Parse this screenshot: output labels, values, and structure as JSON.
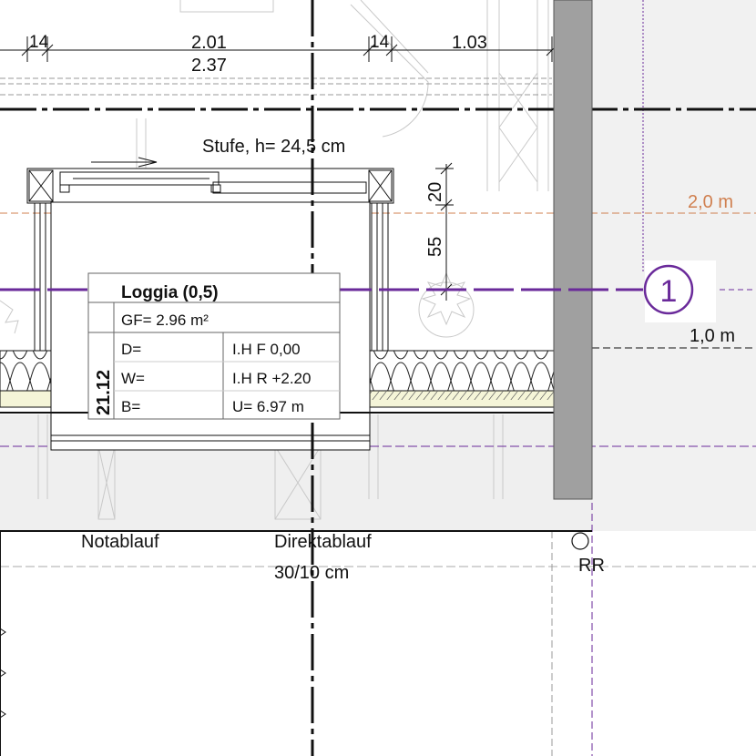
{
  "dimensions": {
    "top_left_14": "14",
    "top_mid_201": "2.01",
    "top_mid_237": "2.37",
    "top_right_14": "14",
    "top_right_103": "1.03",
    "vert_20": "20",
    "vert_55": "55"
  },
  "annotations": {
    "stufe": "Stufe, h= 24,5 cm",
    "notablauf": "Notablauf",
    "direktablauf": "Direktablauf",
    "direktablauf_size": "30/10 cm",
    "rr": "RR"
  },
  "levels": {
    "level_2": "2,0 m",
    "level_1": "1,0 m"
  },
  "axis_marker": {
    "label": "1"
  },
  "room_stamp": {
    "name": "Loggia (0,5)",
    "area": "GF= 2.96 m²",
    "number": "21.12",
    "rows": [
      {
        "left": "D=",
        "right": "I.H F 0,00"
      },
      {
        "left": "W=",
        "right": "I.H R +2.20"
      },
      {
        "left": "B=",
        "right": "U= 6.97 m"
      }
    ]
  },
  "colors": {
    "axis": "#6a2a9a",
    "level_line": "#d08050",
    "wall_fill": "#a0a0a0",
    "floor_fill": "#f5f5d8",
    "area_fill": "#efefef"
  }
}
